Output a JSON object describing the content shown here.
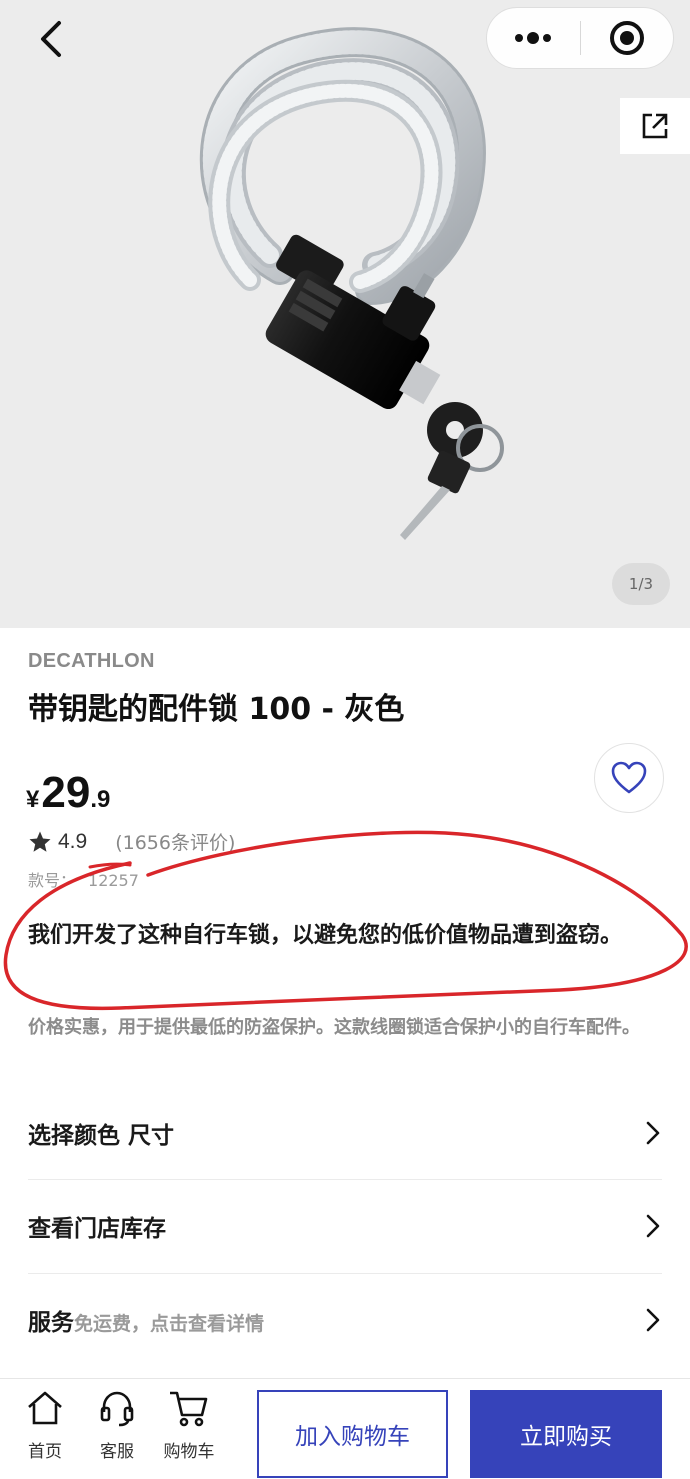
{
  "hero": {
    "page_indicator": "1/3",
    "icons": {
      "back": "back-arrow-icon",
      "more": "more-dots-icon",
      "target": "target-circle-icon",
      "share": "share-external-icon"
    }
  },
  "product": {
    "brand": "DECATHLON",
    "title": "带钥匙的配件锁 100 - 灰色",
    "price": {
      "currency": "¥",
      "integer": "29",
      "decimal": ".9"
    },
    "rating": {
      "score": "4.9",
      "reviews_text": "(1656条评价)"
    },
    "sku": {
      "label": "款号：",
      "value": "12257"
    },
    "description": "我们开发了这种自行车锁，以避免您的低价值物品遭到盗窃。",
    "sub_description": "价格实惠，用于提供最低的防盗保护。这款线圈锁适合保护小的自行车配件。"
  },
  "options": {
    "color_size_label": "选择颜色 尺寸",
    "store_stock_label": "查看门店库存",
    "service_label": "服务",
    "service_note": "免运费，点击查看详情"
  },
  "bottom_bar": {
    "home_label": "首页",
    "service_label": "客服",
    "cart_label": "购物车",
    "add_to_cart": "加入购物车",
    "buy_now": "立即购买"
  },
  "colors": {
    "accent": "#3643ba",
    "annotation": "#d9262a",
    "hero_bg": "#ececec"
  }
}
